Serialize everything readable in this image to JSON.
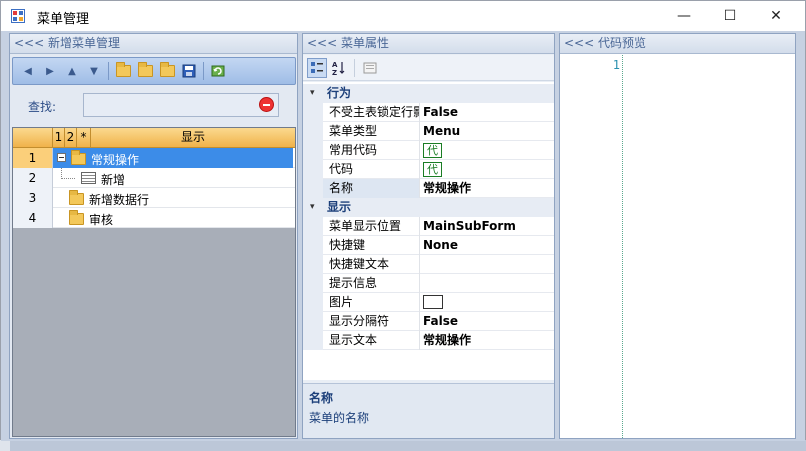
{
  "window": {
    "title": "菜单管理",
    "controls": {
      "minimize": "—",
      "maximize": "☐",
      "close": "✕"
    }
  },
  "left_panel": {
    "header": "<<< 新增菜单管理",
    "toolbar": [
      "first",
      "prev",
      "up",
      "down",
      "folder-add",
      "folder-copy",
      "folder-delete",
      "save",
      "refresh"
    ],
    "search_label": "查找:",
    "search_value": "",
    "grid": {
      "headers": [
        "",
        "1",
        "2",
        "*",
        "显示"
      ],
      "rows": [
        {
          "num": "1",
          "label": "常规操作",
          "kind": "folder",
          "expanded": true,
          "selected": true
        },
        {
          "num": "2",
          "label": "新增",
          "kind": "item",
          "child": true
        },
        {
          "num": "3",
          "label": "新增数据行",
          "kind": "folder"
        },
        {
          "num": "4",
          "label": "审核",
          "kind": "folder"
        }
      ]
    }
  },
  "middle_panel": {
    "header": "<<< 菜单属性",
    "categories": [
      {
        "name": "行为",
        "properties": [
          {
            "name": "不受主表锁定行影响",
            "value": "False"
          },
          {
            "name": "菜单类型",
            "value": "Menu"
          },
          {
            "name": "常用代码",
            "value": "代",
            "badge": true
          },
          {
            "name": "代码",
            "value": "代",
            "badge": true
          },
          {
            "name": "名称",
            "value": "常规操作",
            "selected": true
          }
        ]
      },
      {
        "name": "显示",
        "properties": [
          {
            "name": "菜单显示位置",
            "value": "MainSubForm"
          },
          {
            "name": "快捷键",
            "value": "None"
          },
          {
            "name": "快捷键文本",
            "value": ""
          },
          {
            "name": "提示信息",
            "value": ""
          },
          {
            "name": "图片",
            "value": "",
            "image": true
          },
          {
            "name": "显示分隔符",
            "value": "False"
          },
          {
            "name": "显示文本",
            "value": "常规操作"
          }
        ]
      }
    ],
    "description": {
      "title": "名称",
      "text": "菜单的名称"
    }
  },
  "right_panel": {
    "header": "<<< 代码预览",
    "line_number": "1"
  }
}
